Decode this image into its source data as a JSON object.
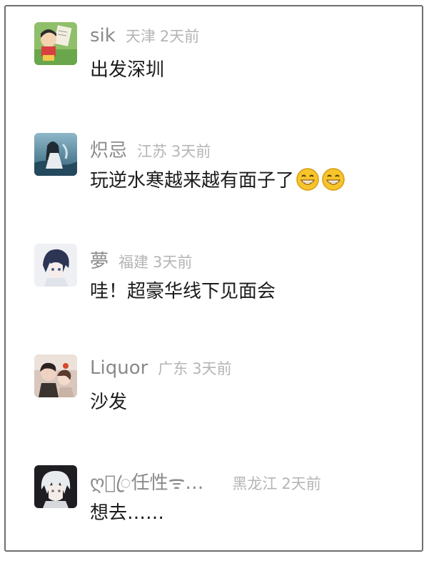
{
  "comments": [
    {
      "name": "sik",
      "location": "天津",
      "time": "2天前",
      "text": "出发深圳",
      "avatar": "cartoon-boy-avatar",
      "emoji_count": 0
    },
    {
      "name": "炽忌",
      "location": "江苏",
      "time": "3天前",
      "text": "玩逆水寒越来越有面子了",
      "avatar": "ocean-girl-avatar",
      "emoji_count": 2,
      "emoji": "grinning-face-icon"
    },
    {
      "name": "夢",
      "location": "福建",
      "time": "3天前",
      "text": "哇！超豪华线下见面会",
      "avatar": "anime-boy-avatar",
      "emoji_count": 0
    },
    {
      "name": "Liquor",
      "location": "广东",
      "time": "3天前",
      "text": "沙发",
      "avatar": "couple-photo-avatar",
      "emoji_count": 0
    },
    {
      "name": "ღ⃝ꦿ任性ᯤ…",
      "location": "黑龙江",
      "time": "2天前",
      "text": "想去……",
      "avatar": "white-hair-avatar",
      "emoji_count": 0
    }
  ],
  "colors": {
    "name": "#8a8a8a",
    "meta": "#b5b5b5",
    "text": "#1b1b1b",
    "border": "#6e6e6e"
  }
}
